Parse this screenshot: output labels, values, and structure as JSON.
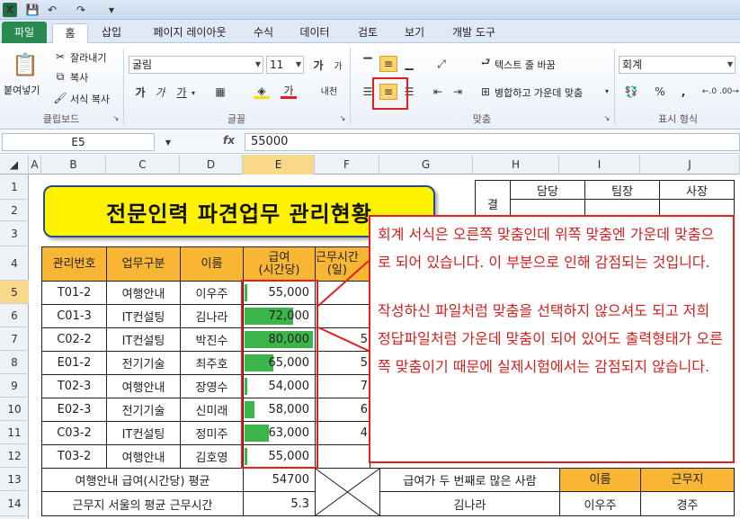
{
  "ribbon_tabs": [
    "파일",
    "홈",
    "삽입",
    "페이지 레이아웃",
    "수식",
    "데이터",
    "검토",
    "보기",
    "개발 도구"
  ],
  "clipboard": {
    "paste": "붙여넣기",
    "cut": "잘라내기",
    "copy": "복사",
    "format_painter": "서식 복사",
    "label": "클립보드"
  },
  "font": {
    "name": "굴림",
    "size": "11",
    "label": "글꼴",
    "grow": "가",
    "shrink": "가",
    "bold": "가",
    "italic": "가",
    "underline": "가",
    "fontcolor": "가",
    "phonetic": "내천"
  },
  "alignment": {
    "wrap": "텍스트 줄 바꿈",
    "merge": "병합하고 가운데 맞춤",
    "label": "맞춤"
  },
  "number": {
    "format": "회계",
    "label": "표시 형식",
    "percent": "%",
    "comma": ","
  },
  "formula_bar": {
    "name_box": "E5",
    "fx": "fx",
    "value": "55000"
  },
  "columns": [
    "A",
    "B",
    "C",
    "D",
    "E",
    "F",
    "G",
    "H",
    "I",
    "J"
  ],
  "rows": [
    "1",
    "2",
    "3",
    "4",
    "5",
    "6",
    "7",
    "8",
    "9",
    "10",
    "11",
    "12",
    "13",
    "14"
  ],
  "sheet_title": "전문인력 파견업무 관리현황",
  "approval": {
    "gyeol": "결",
    "c1": "담당",
    "c2": "팀장",
    "c3": "사장"
  },
  "table_headers": {
    "id": "관리번호",
    "type": "업무구분",
    "name": "이름",
    "pay": "급여\n(시간당)",
    "hours": "근무시간\n(일)"
  },
  "table_rows": [
    {
      "id": "T01-2",
      "type": "여행안내",
      "name": "이우주",
      "pay": "55,000",
      "pay_fraction": 0.03
    },
    {
      "id": "C01-3",
      "type": "IT컨설팅",
      "name": "김나라",
      "pay": "72,000",
      "pay_fraction": 0.71
    },
    {
      "id": "C02-2",
      "type": "IT컨설팅",
      "name": "박진수",
      "pay": "80,000",
      "pay_fraction": 1.0
    },
    {
      "id": "E01-2",
      "type": "전기기술",
      "name": "최주호",
      "pay": "65,000",
      "pay_fraction": 0.42
    },
    {
      "id": "T02-3",
      "type": "여행안내",
      "name": "장영수",
      "pay": "54,000",
      "pay_fraction": 0.0
    },
    {
      "id": "E02-3",
      "type": "전기기술",
      "name": "신미래",
      "pay": "58,000",
      "pay_fraction": 0.15
    },
    {
      "id": "C03-2",
      "type": "IT컨설팅",
      "name": "정미주",
      "pay": "63,000",
      "pay_fraction": 0.35
    },
    {
      "id": "T03-2",
      "type": "여행안내",
      "name": "김호영",
      "pay": "55,000",
      "pay_fraction": 0.03
    }
  ],
  "hours_partial": [
    "5",
    "5",
    "7",
    "6",
    "4"
  ],
  "summary": {
    "r13_label": "여행안내 급여(시간당) 평균",
    "r13_value": "54700",
    "r14_label": "근무지 서울의 평균 근무시간",
    "r14_value": "5.3",
    "second_pay_label": "급여가 두 번째로 많은 사람",
    "col_name": "이름",
    "col_work": "근무지",
    "second_pay_value": "김나라",
    "name_value": "이우주",
    "work_value": "경주"
  },
  "callout": {
    "p1": "회계 서식은 오른쪽 맞춤인데 위쪽 맞춤엔 가운데 맞춤으로 되어 있습니다. 이 부분으로 인해 감점되는 것입니다.",
    "p2": "작성하신 파일처럼 맞춤을 선택하지 않으셔도 되고 저희 정답파일처럼 가운데 맞춤이 되어 있어도 출력형태가 오른쪽 맞춤이기 때문에 실제시험에서는 감점되지 않습니다."
  },
  "colors": {
    "accent": "#e0201e",
    "header_fill": "#f9b534",
    "bar": "#3bb44a",
    "title_fill": "#fff200"
  }
}
